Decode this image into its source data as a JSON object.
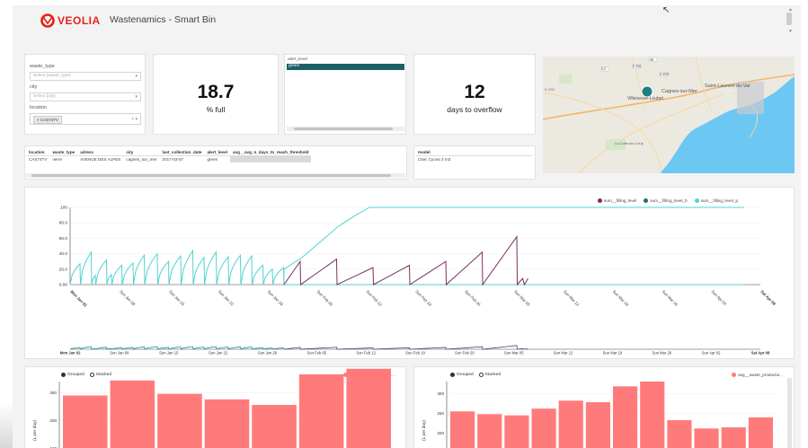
{
  "header": {
    "logo_text": "VEOLIA",
    "app_title": "Wastenamics - Smart Bin"
  },
  "filters": {
    "waste_type": {
      "label": "waste_type",
      "placeholder": "Select [waste_type]"
    },
    "city": {
      "label": "city",
      "placeholder": "Select [city]"
    },
    "location": {
      "label": "location",
      "tag": "× CAS74TV"
    }
  },
  "alert_level": {
    "label": "alert_level",
    "selected": "green"
  },
  "kpi_fill": {
    "value": "18.7",
    "label": "% full"
  },
  "kpi_overflow": {
    "value": "12",
    "label": "days to overflow"
  },
  "map": {
    "places": [
      "Saint-Laurent-du-Var",
      "Cagnes-sur-Mer",
      "Villeneuve-Loubet",
      "La Colle-sur-Loup"
    ],
    "roads": [
      "D 236",
      "D 336",
      "D 2",
      "D 6007",
      "A8"
    ]
  },
  "detail_table": {
    "columns": [
      "location",
      "waste_type",
      "adress",
      "city",
      "last_collection_date",
      "alert_level",
      "avg__avg_n_days_to_reach_threshold"
    ],
    "rows": [
      [
        "CAS74TV",
        "verre",
        "AVENUE DES ALPES",
        "cagnes_sur_mer",
        "2017-03-07",
        "green",
        ""
      ]
    ]
  },
  "model_table": {
    "columns": [
      "model"
    ],
    "rows": [
      [
        "Citec Cycea 3 m3"
      ]
    ]
  },
  "line_chart": {
    "legend": [
      "sum__filling_level",
      "sum__filling_level_b",
      "sum__filling_level_p"
    ],
    "colors": [
      "#7c2d62",
      "#1f6f78",
      "#4fd3cf"
    ],
    "yticks": [
      "100",
      "80.0",
      "60.0",
      "40.0",
      "20.0",
      "0.00"
    ],
    "xticks": [
      "Mon Jan 02",
      "Sun Jan 08",
      "Sun Jan 15",
      "Sun Jan 22",
      "Sun Jan 29",
      "Sun Feb 05",
      "Sun Feb 12",
      "Sun Feb 19",
      "Sun Feb 26",
      "Sun Mar 05",
      "Sun Mar 12",
      "Sun Mar 19",
      "Sun Mar 26",
      "Sun Apr 02",
      "Sat Apr 08"
    ],
    "brush_ticks": [
      "Mon Jan 02",
      "Sun Jan 08",
      "Sun Jan 15",
      "Sun Jan 22",
      "Sun Jan 29",
      "Sun Feb 05",
      "Sun Feb 12",
      "Sun Feb 19",
      "Sun Feb 26",
      "Sun Mar 05",
      "Sun Mar 12",
      "Sun Mar 19",
      "Sun Mar 26",
      "Sun Apr 02",
      "Sat Apr 08"
    ]
  },
  "bar_left": {
    "radios": [
      "Grouped",
      "Stacked"
    ],
    "legend": "avg__waste_productio...",
    "ylabel": "(L per day)",
    "yticks": [
      "250",
      "200",
      "150"
    ]
  },
  "bar_right": {
    "radios": [
      "Grouped",
      "Stacked"
    ],
    "legend": "avg__waste_productio...",
    "ylabel": "(L per day)",
    "yticks": [
      "350",
      "300",
      "250",
      "200",
      "150"
    ]
  },
  "chart_data": [
    {
      "type": "line",
      "ylim": [
        0,
        100
      ],
      "xlabel": "",
      "ylabel": "",
      "series": [
        {
          "name": "sum__filling_level",
          "values": []
        },
        {
          "name": "sum__filling_level_b",
          "values": []
        },
        {
          "name": "sum__filling_level_p",
          "values": []
        }
      ]
    },
    {
      "type": "bar",
      "ylabel": "(L per day)",
      "series": [
        {
          "name": "avg__waste_productio...",
          "values": [
            245,
            272,
            248,
            238,
            228,
            283,
            293
          ]
        }
      ]
    },
    {
      "type": "bar",
      "ylabel": "(L per day)",
      "series": [
        {
          "name": "avg__waste_productio...",
          "values": [
            255,
            248,
            245,
            262,
            282,
            278,
            318,
            330,
            233,
            212,
            215,
            240
          ]
        }
      ]
    }
  ],
  "colors": {
    "brand_red": "#e3241b",
    "bar_pink": "#ff7b7b",
    "teal_dark": "#1f6f78",
    "teal_light": "#4fd3cf",
    "plum": "#7c2d62",
    "sea": "#6cc8f2"
  }
}
